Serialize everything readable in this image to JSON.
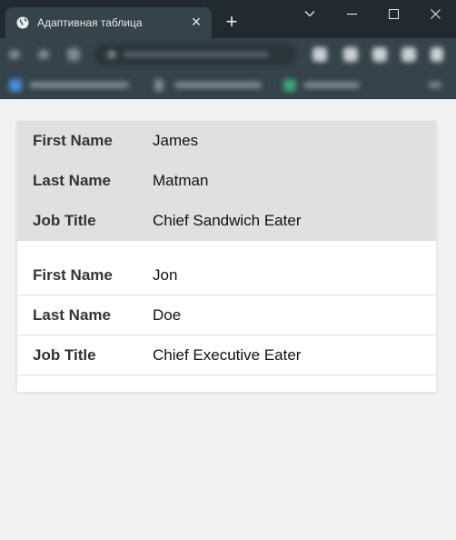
{
  "browser": {
    "tab_title": "Адаптивная таблица",
    "tab_close": "×",
    "new_tab": "+"
  },
  "table": {
    "groups": [
      {
        "rows": [
          {
            "header": "First Name",
            "value": "James"
          },
          {
            "header": "Last Name",
            "value": "Matman"
          },
          {
            "header": "Job Title",
            "value": "Chief Sandwich Eater"
          }
        ]
      },
      {
        "rows": [
          {
            "header": "First Name",
            "value": "Jon"
          },
          {
            "header": "Last Name",
            "value": "Doe"
          },
          {
            "header": "Job Title",
            "value": "Chief Executive Eater"
          }
        ]
      }
    ]
  },
  "colors": {
    "tabstrip": "#202a30",
    "toolbar": "#35434a",
    "page_background": "#f2f2f2",
    "highlighted_group": "#e0e0e0"
  }
}
